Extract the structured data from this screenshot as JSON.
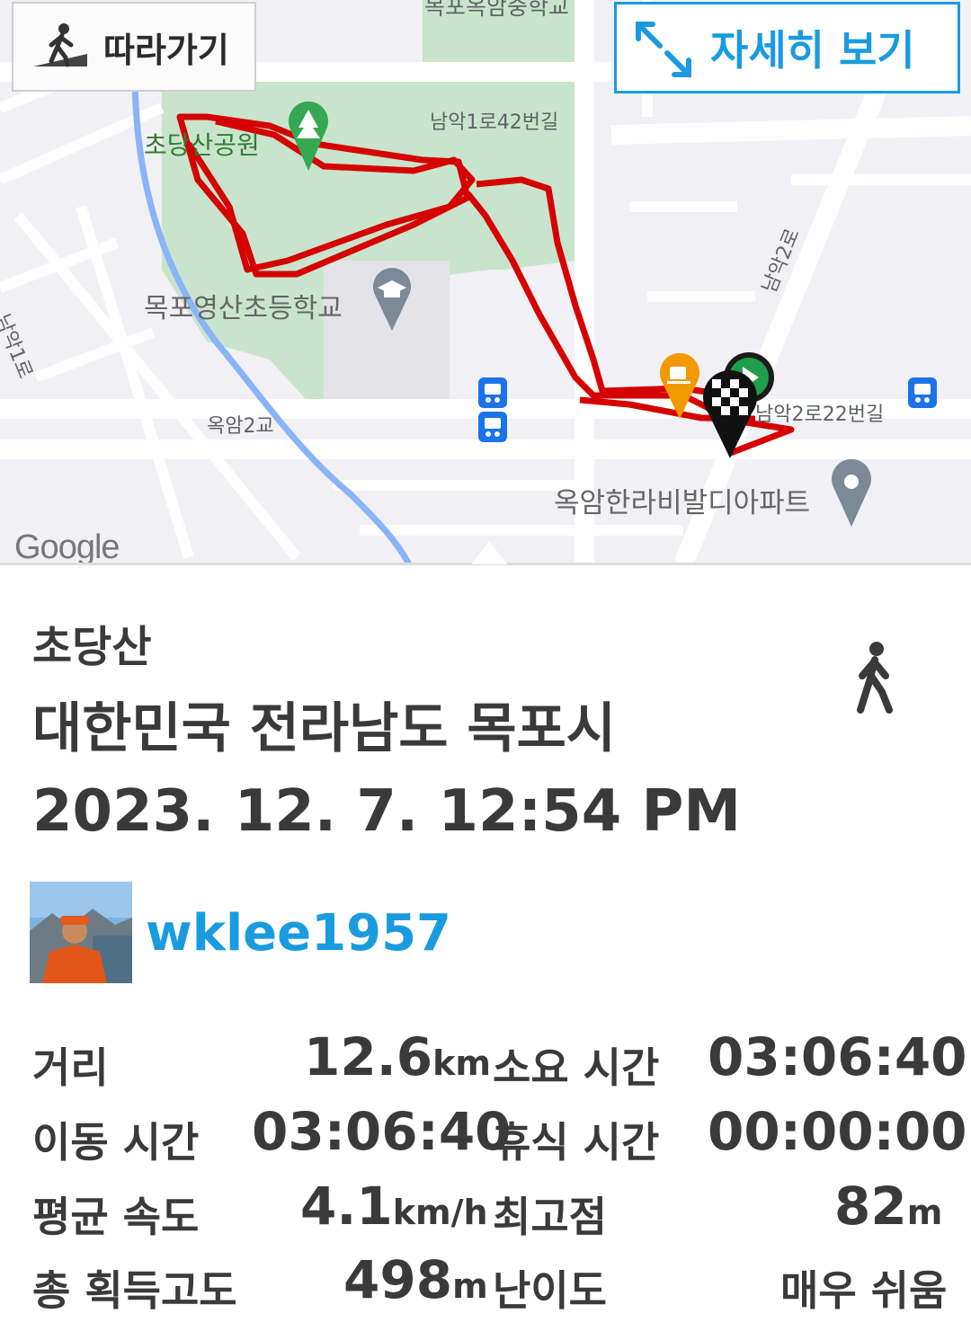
{
  "map": {
    "labels": {
      "school_top": "목포옥암중학교",
      "park": "초당산공원",
      "road1": "남악1로42번길",
      "road2": "남악2로",
      "road3": "남악1로",
      "school": "목포영산초등학교",
      "bridge": "옥암2교",
      "road4": "남악2로22번길",
      "apartment": "옥암한라비발디아파트"
    },
    "google": "Google"
  },
  "toolbar": {
    "follow_label": "따라가기",
    "detail_label": "자세히 보기"
  },
  "track": {
    "title": "초당산",
    "location": "대한민국 전라남도 목포시",
    "datetime": "2023. 12. 7. 12:54 PM",
    "activity_icon": "walking-person-icon"
  },
  "user": {
    "username": "wklee1957"
  },
  "stats": {
    "distance_label": "거리",
    "distance_value": "12.6",
    "distance_unit": "km",
    "duration_label": "소요 시간",
    "duration_value": "03:06:40",
    "moving_label": "이동 시간",
    "moving_value": "03:06:40",
    "rest_label": "휴식 시간",
    "rest_value": "00:00:00",
    "speed_label": "평균 속도",
    "speed_value": "4.1",
    "speed_unit": "km/h",
    "max_alt_label": "최고점",
    "max_alt_value": "82",
    "max_alt_unit": "m",
    "gain_label": "총 획득고도",
    "gain_value": "498",
    "gain_unit": "m",
    "difficulty_label": "난이도",
    "difficulty_value": "매우 쉬움"
  },
  "colors": {
    "accent": "#1a9be0",
    "track": "#d50000",
    "text": "#3a3a3a"
  }
}
